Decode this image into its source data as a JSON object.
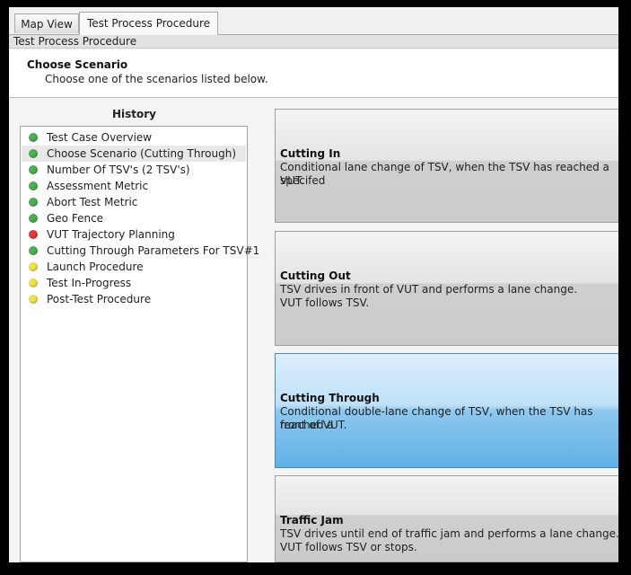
{
  "tabs": [
    {
      "label": "Map View"
    },
    {
      "label": "Test Process Procedure"
    }
  ],
  "subheader": "Test Process Procedure",
  "scenario": {
    "title": "Choose Scenario",
    "description": "Choose one of the scenarios listed below."
  },
  "history": {
    "title": "History",
    "items": [
      {
        "label": "Test Case Overview",
        "status": "green"
      },
      {
        "label": "Choose Scenario (Cutting Through)",
        "status": "green"
      },
      {
        "label": "Number Of TSV's (2 TSV's)",
        "status": "green"
      },
      {
        "label": "Assessment Metric",
        "status": "green"
      },
      {
        "label": "Abort Test Metric",
        "status": "green"
      },
      {
        "label": "Geo Fence",
        "status": "green"
      },
      {
        "label": "VUT Trajectory Planning",
        "status": "red"
      },
      {
        "label": "Cutting Through Parameters For TSV#1",
        "status": "green"
      },
      {
        "label": "Launch Procedure",
        "status": "yellow"
      },
      {
        "label": "Test In-Progress",
        "status": "yellow"
      },
      {
        "label": "Post-Test Procedure",
        "status": "yellow"
      }
    ]
  },
  "cards": [
    {
      "title": "Cutting In",
      "line1": "Conditional lane change of TSV, when the TSV has reached a specifed",
      "line2": "VUT."
    },
    {
      "title": "Cutting Out",
      "line1": "TSV drives in front of VUT and performs a lane change.",
      "line2": "VUT follows TSV."
    },
    {
      "title": "Cutting Through",
      "line1": "Conditional double-lane change of TSV, when the TSV has reached a",
      "line2": "front of VUT."
    },
    {
      "title": "Traffic Jam",
      "line1": "TSV drives until end of traffic jam and performs a lane change.",
      "line2": "VUT follows TSV or stops."
    }
  ],
  "colors": {
    "status_green": "#4caf50",
    "status_red": "#e03c3c",
    "status_yellow": "#f2e04a",
    "selected_card": "#6bb8ea"
  }
}
